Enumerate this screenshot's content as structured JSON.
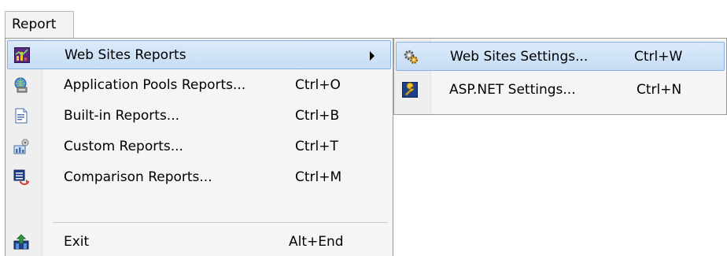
{
  "menubar": {
    "report_label": "Report"
  },
  "menu": {
    "items": [
      {
        "label": "Web Sites Reports",
        "shortcut": "",
        "icon": "chart-icon"
      },
      {
        "label": "Application Pools Reports...",
        "shortcut": "Ctrl+O",
        "icon": "globe-server-icon"
      },
      {
        "label": "Built-in Reports...",
        "shortcut": "Ctrl+B",
        "icon": "document-icon"
      },
      {
        "label": "Custom Reports...",
        "shortcut": "Ctrl+T",
        "icon": "custom-chart-icon"
      },
      {
        "label": "Comparison Reports...",
        "shortcut": "Ctrl+M",
        "icon": "compare-icon"
      },
      {
        "label": "Exit",
        "shortcut": "Alt+End",
        "icon": "exit-icon"
      }
    ]
  },
  "submenu": {
    "items": [
      {
        "label": "Web Sites Settings...",
        "shortcut": "Ctrl+W",
        "icon": "gears-icon"
      },
      {
        "label": "ASP.NET Settings...",
        "shortcut": "Ctrl+N",
        "icon": "wrench-icon"
      }
    ]
  },
  "colors": {
    "highlight": "#c6ddf5",
    "highlight_border": "#86b3e6",
    "menu_bg": "#f5f5f5"
  }
}
